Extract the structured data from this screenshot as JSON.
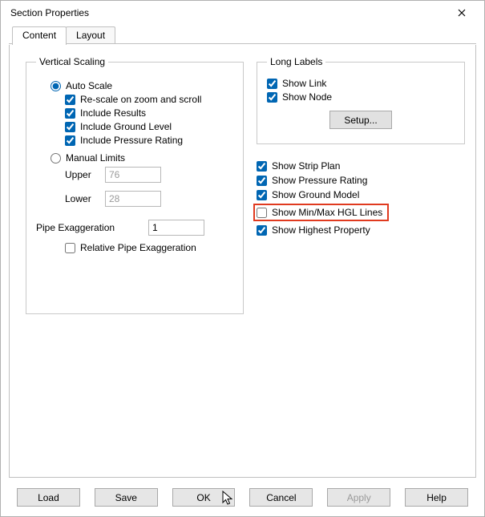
{
  "window": {
    "title": "Section Properties"
  },
  "tabs": {
    "content": "Content",
    "layout": "Layout"
  },
  "vertical_scaling": {
    "legend": "Vertical Scaling",
    "auto_scale": "Auto Scale",
    "rescale": "Re-scale on zoom and scroll",
    "include_results": "Include Results",
    "include_ground": "Include Ground Level",
    "include_pressure": "Include Pressure Rating",
    "manual_limits": "Manual Limits",
    "upper_label": "Upper",
    "upper_value": "76",
    "lower_label": "Lower",
    "lower_value": "28",
    "pipe_exag_label": "Pipe Exaggeration",
    "pipe_exag_value": "1",
    "relative_exag": "Relative Pipe Exaggeration"
  },
  "long_labels": {
    "legend": "Long Labels",
    "show_link": "Show Link",
    "show_node": "Show Node",
    "setup": "Setup..."
  },
  "right_checks": {
    "strip_plan": "Show Strip Plan",
    "pressure_rating": "Show Pressure Rating",
    "ground_model": "Show Ground Model",
    "hgl_lines": "Show Min/Max HGL Lines",
    "highest_prop": "Show Highest Property"
  },
  "buttons": {
    "load": "Load",
    "save": "Save",
    "ok": "OK",
    "cancel": "Cancel",
    "apply": "Apply",
    "help": "Help"
  }
}
